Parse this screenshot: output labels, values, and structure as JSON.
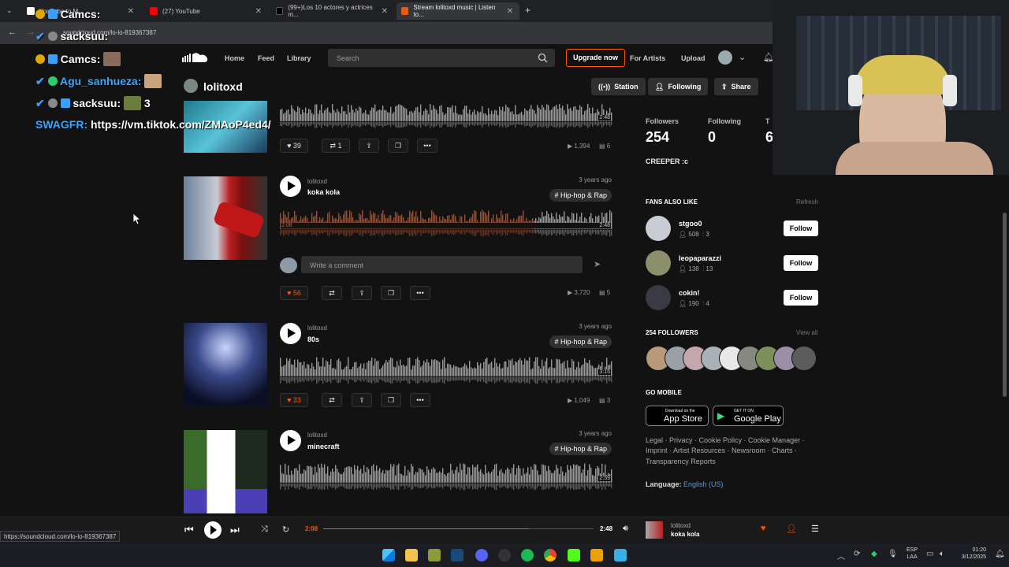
{
  "browser": {
    "tabs": [
      {
        "label": "YouTube to M..."
      },
      {
        "label": "(27) YouTube"
      },
      {
        "label": "(99+)Los 10 actores y actrices m..."
      },
      {
        "label": "Stream lolitoxd music | Listen to..."
      }
    ],
    "url": "soundcloud.com/lo-lo-819367387",
    "status_url": "https://soundcloud.com/lo-lo-819367387"
  },
  "header": {
    "nav": [
      "Home",
      "Feed",
      "Library"
    ],
    "search_placeholder": "Search",
    "upgrade": "Upgrade now",
    "for_artists": "For Artists",
    "upload": "Upload"
  },
  "profile": {
    "name": "lolitoxd",
    "station": "Station",
    "following": "Following",
    "share": "Share"
  },
  "chat": [
    {
      "name": "Camcs:",
      "text": ""
    },
    {
      "name": "Agu_sanhueza:",
      "text": ""
    },
    {
      "name": "sacksuu:",
      "text": "3"
    },
    {
      "name": "SWAGFR:",
      "text": "https://vm.tiktok.com/ZMAoP4ed4/"
    }
  ],
  "tracks": [
    {
      "user": "",
      "title": "",
      "ago": "",
      "tag": "",
      "duration": "2:48",
      "likes": "39",
      "reposts": "1",
      "plays": "1,394",
      "comments": "6"
    },
    {
      "user": "lolitoxd",
      "title": "koka kola",
      "ago": "3 years ago",
      "tag": "# Hip-hop & Rap",
      "duration": "2:48",
      "elapsed": "2:08",
      "likes": "56",
      "reposts": "",
      "plays": "3,720",
      "comments": "5",
      "comment_placeholder": "Write a comment",
      "progress": 0.76
    },
    {
      "user": "lolitoxd",
      "title": "80s",
      "ago": "3 years ago",
      "tag": "# Hip-hop & Rap",
      "duration": "3:15",
      "likes": "33",
      "reposts": "",
      "plays": "1,049",
      "comments": "3"
    },
    {
      "user": "lolitoxd",
      "title": "minecraft",
      "ago": "3 years ago",
      "tag": "# Hip-hop & Rap",
      "duration": "2:59"
    }
  ],
  "sidebar": {
    "followers_label": "Followers",
    "followers": "254",
    "following_label": "Following",
    "following": "0",
    "tracks_label": "T",
    "tracks": "6",
    "bio": "CREEPER :c",
    "fans_title": "FANS ALSO LIKE",
    "refresh": "Refresh",
    "fans": [
      {
        "name": "stgoo0",
        "followers": "508",
        "tracks": "3",
        "follow": "Follow"
      },
      {
        "name": "leopaparazzi",
        "followers": "138",
        "tracks": "13",
        "follow": "Follow"
      },
      {
        "name": "cokin!",
        "followers": "190",
        "tracks": "4",
        "follow": "Follow"
      }
    ],
    "followers_title": "254 FOLLOWERS",
    "view_all": "View all",
    "go_mobile": "GO MOBILE",
    "appstore_small": "Download on the",
    "appstore_big": "App Store",
    "googleplay_small": "GET IT ON",
    "googleplay_big": "Google Play",
    "footer_line1": "Legal · Privacy · Cookie Policy · Cookie Manager ·",
    "footer_line2": "Imprint · Artist Resources · Newsroom · Charts ·",
    "footer_line3": "Transparency Reports",
    "language_label": "Language:",
    "language_value": "English (US)"
  },
  "player": {
    "elapsed": "2:08",
    "total": "2:48",
    "progress": 0.76,
    "artist": "lolitoxd",
    "title": "koka kola"
  },
  "taskbar": {
    "lang1": "ESP",
    "lang2": "LAA",
    "time": "01:20",
    "date": "3/12/2025"
  },
  "colors": {
    "accent": "#ff5500",
    "played": "#c2410c"
  }
}
